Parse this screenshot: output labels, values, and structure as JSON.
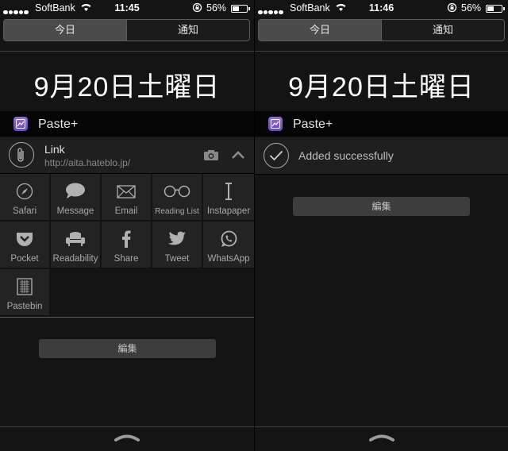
{
  "left": {
    "status": {
      "carrier": "SoftBank",
      "time": "11:45",
      "battery": "56%",
      "battery_level": 0.56
    },
    "tabs": [
      {
        "label": "今日",
        "active": true
      },
      {
        "label": "通知",
        "active": false
      }
    ],
    "date": "9月20日土曜日",
    "widget": {
      "app_name": "Paste+",
      "link_title": "Link",
      "link_url": "http://aita.hateblo.jp/",
      "actions": [
        {
          "label": "Safari",
          "icon": "compass-icon"
        },
        {
          "label": "Message",
          "icon": "speech-bubble-icon"
        },
        {
          "label": "Email",
          "icon": "envelope-icon"
        },
        {
          "label": "Reading List",
          "icon": "glasses-icon"
        },
        {
          "label": "Instapaper",
          "icon": "instapaper-icon"
        },
        {
          "label": "Pocket",
          "icon": "pocket-icon"
        },
        {
          "label": "Readability",
          "icon": "armchair-icon"
        },
        {
          "label": "Share",
          "icon": "facebook-icon"
        },
        {
          "label": "Tweet",
          "icon": "twitter-bird-icon"
        },
        {
          "label": "WhatsApp",
          "icon": "whatsapp-icon"
        },
        {
          "label": "Pastebin",
          "icon": "pastebin-icon"
        }
      ]
    },
    "edit_label": "編集"
  },
  "right": {
    "status": {
      "carrier": "SoftBank",
      "time": "11:46",
      "battery": "56%",
      "battery_level": 0.56
    },
    "tabs": [
      {
        "label": "今日",
        "active": true
      },
      {
        "label": "通知",
        "active": false
      }
    ],
    "date": "9月20日土曜日",
    "widget": {
      "app_name": "Paste+",
      "message": "Added successfully"
    },
    "edit_label": "編集"
  },
  "colors": {
    "background": "#141414",
    "widget_row": "#1f1f1f",
    "app_icon": "#7b58d4",
    "button": "#3d3d3d"
  }
}
